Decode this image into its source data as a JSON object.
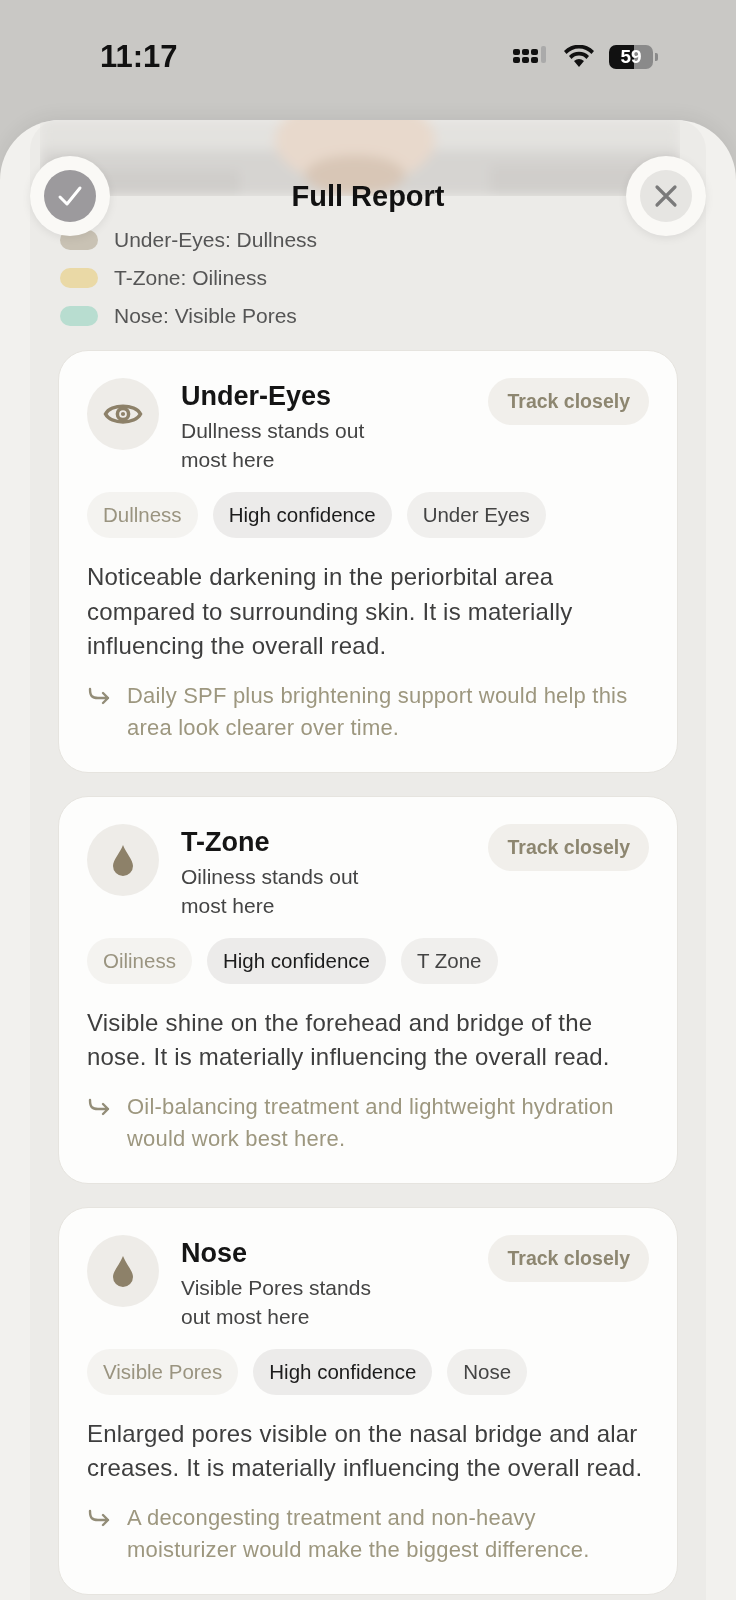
{
  "status_bar": {
    "time": "11:17",
    "battery": "59"
  },
  "header": {
    "title": "Full Report"
  },
  "legend": [
    {
      "label": "Under-Eyes: Dullness",
      "color": "#c9c2b4"
    },
    {
      "label": "T-Zone: Oiliness",
      "color": "#ead9a6"
    },
    {
      "label": "Nose: Visible Pores",
      "color": "#b8ddd0"
    }
  ],
  "areas": [
    {
      "kind": "eye",
      "title": "Under-Eyes",
      "subtitle": "Dullness stands out most here",
      "badge": "Track closely",
      "chips": [
        {
          "label": "Dullness",
          "kind": "concern"
        },
        {
          "label": "High confidence",
          "kind": "confidence"
        },
        {
          "label": "Under Eyes",
          "kind": "zone"
        }
      ],
      "description": "Noticeable darkening in the periorbital area compared to surrounding skin. It is materially influencing the overall read.",
      "tip": "Daily SPF plus brightening support would help this area look clearer over time."
    },
    {
      "kind": "drop",
      "title": "T-Zone",
      "subtitle": "Oiliness stands out most here",
      "badge": "Track closely",
      "chips": [
        {
          "label": "Oiliness",
          "kind": "concern"
        },
        {
          "label": "High confidence",
          "kind": "confidence"
        },
        {
          "label": "T Zone",
          "kind": "zone"
        }
      ],
      "description": "Visible shine on the forehead and bridge of the nose. It is materially influencing the overall read.",
      "tip": "Oil-balancing treatment and lightweight hydration would work best here."
    },
    {
      "kind": "drop",
      "title": "Nose",
      "subtitle": "Visible Pores stands out most here",
      "badge": "Track closely",
      "chips": [
        {
          "label": "Visible Pores",
          "kind": "concern"
        },
        {
          "label": "High confidence",
          "kind": "confidence"
        },
        {
          "label": "Nose",
          "kind": "zone"
        }
      ],
      "description": "Enlarged pores visible on the nasal bridge and alar creases. It is materially influencing the overall read.",
      "tip": "A decongesting treatment and non-heavy moisturizer would make the biggest difference."
    }
  ]
}
